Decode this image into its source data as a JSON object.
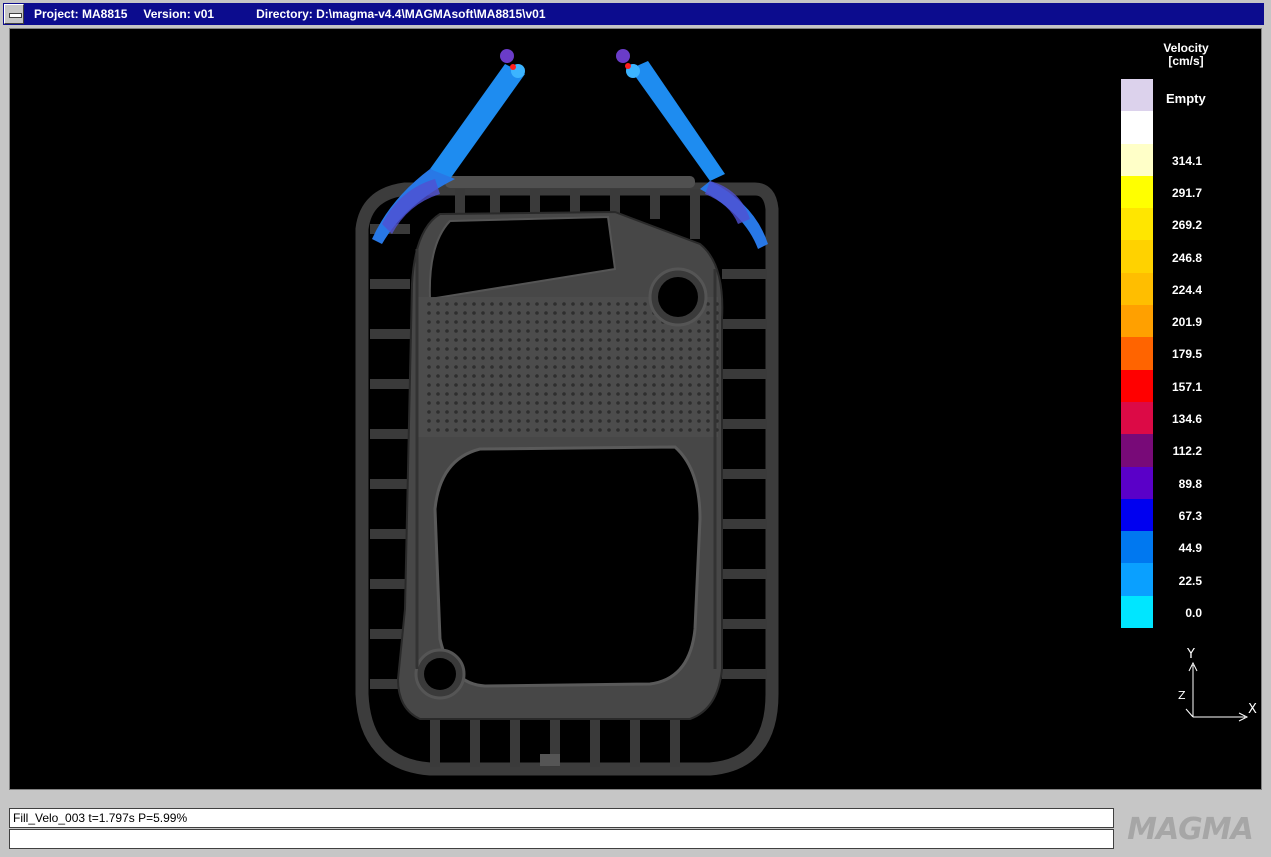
{
  "titlebar": {
    "project": "Project: MA8815",
    "version": "Version: v01",
    "directory": "Directory: D:\\magma-v4.4\\MAGMAsoft\\MA8815\\v01"
  },
  "legend": {
    "title_line1": "Velocity",
    "title_line2": "[cm/s]",
    "empty_label": "Empty",
    "empty_color": "#dcd2ec",
    "entries": [
      {
        "label": "",
        "color": "#ffffff"
      },
      {
        "label": "314.1",
        "color": "#ffffc8"
      },
      {
        "label": "291.7",
        "color": "#ffff00"
      },
      {
        "label": "269.2",
        "color": "#ffe600"
      },
      {
        "label": "246.8",
        "color": "#ffd200"
      },
      {
        "label": "224.4",
        "color": "#ffbe00"
      },
      {
        "label": "201.9",
        "color": "#ffa000"
      },
      {
        "label": "179.5",
        "color": "#ff6400"
      },
      {
        "label": "157.1",
        "color": "#ff0000"
      },
      {
        "label": "134.6",
        "color": "#dc0a46"
      },
      {
        "label": "112.2",
        "color": "#780a78"
      },
      {
        "label": "89.8",
        "color": "#5a00c8"
      },
      {
        "label": "67.3",
        "color": "#0000f0"
      },
      {
        "label": "44.9",
        "color": "#0078f0"
      },
      {
        "label": "22.5",
        "color": "#0aa0ff"
      },
      {
        "label": "0.0",
        "color": "#00e6ff"
      }
    ]
  },
  "axes": {
    "y": "Y",
    "x": "X",
    "z": "Z"
  },
  "status": {
    "line1": "Fill_Velo_003 t=1.797s P=5.99%",
    "line2": ""
  },
  "logo": {
    "text": "MAGMA"
  },
  "colors": {
    "titlebar": "#0c0c8e",
    "casting": "#464646",
    "flow_blue": "#1e8cf0",
    "flow_light": "#3cb4ff"
  },
  "icons": {
    "system_menu": "system-menu-icon",
    "axis": "axis-triad-icon"
  }
}
